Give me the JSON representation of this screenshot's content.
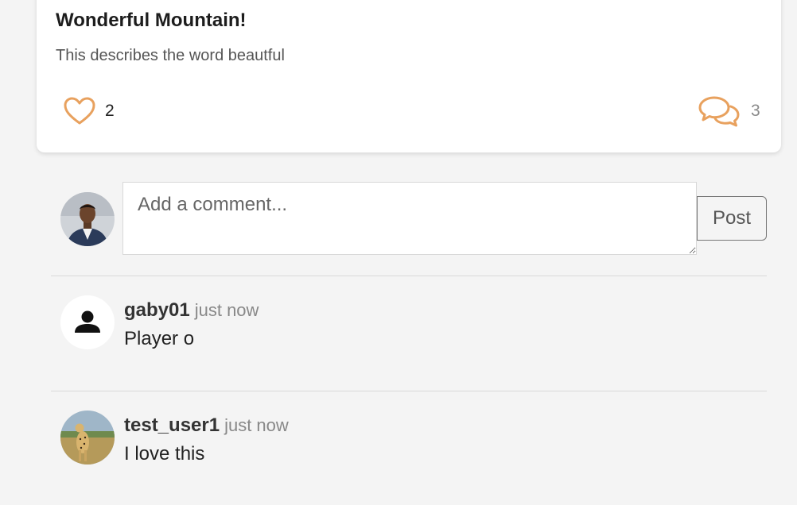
{
  "post": {
    "title": "Wonderful Mountain!",
    "description": "This describes the word beautful",
    "likes": "2",
    "comments_count": "3",
    "accent_color": "#e8a15e"
  },
  "composer": {
    "placeholder": "Add a comment...",
    "post_label": "Post"
  },
  "comments": [
    {
      "username": "gaby01",
      "time": "just now",
      "text": "Player o"
    },
    {
      "username": "test_user1",
      "time": "just now",
      "text": "I love this"
    }
  ]
}
